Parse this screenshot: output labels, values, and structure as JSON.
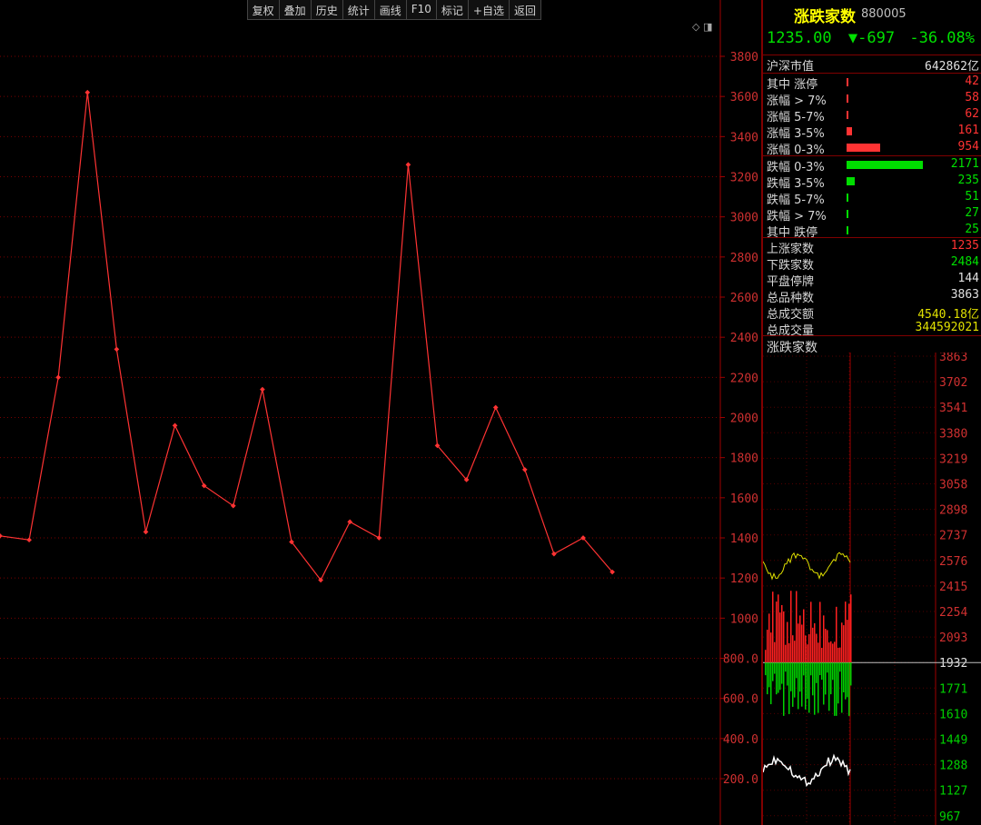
{
  "toolbar": [
    "复权",
    "叠加",
    "历史",
    "统计",
    "画线",
    "F10",
    "标记",
    "+自选",
    "返回"
  ],
  "header": {
    "title": "涨跌家数",
    "code": "880005",
    "price": "1235.00",
    "change": "-697",
    "change_pct": "-36.08%",
    "arrow": "▼"
  },
  "market_cap": {
    "label": "沪深市值",
    "value": "642862亿"
  },
  "rise_rows": [
    {
      "label": "其中 涨停",
      "value": "42",
      "count": 42
    },
    {
      "label": "涨幅 > 7%",
      "value": "58",
      "count": 58
    },
    {
      "label": "涨幅 5-7%",
      "value": "62",
      "count": 62
    },
    {
      "label": "涨幅 3-5%",
      "value": "161",
      "count": 161
    },
    {
      "label": "涨幅 0-3%",
      "value": "954",
      "count": 954
    }
  ],
  "fall_rows": [
    {
      "label": "跌幅 0-3%",
      "value": "2171",
      "count": 2171
    },
    {
      "label": "跌幅 3-5%",
      "value": "235",
      "count": 235
    },
    {
      "label": "跌幅 5-7%",
      "value": "51",
      "count": 51
    },
    {
      "label": "跌幅 > 7%",
      "value": "27",
      "count": 27
    },
    {
      "label": "其中 跌停",
      "value": "25",
      "count": 25
    }
  ],
  "stats": [
    {
      "label": "上涨家数",
      "value": "1235",
      "color": "red"
    },
    {
      "label": "下跌家数",
      "value": "2484",
      "color": "green"
    },
    {
      "label": "平盘停牌",
      "value": "144",
      "color": "white"
    },
    {
      "label": "总品种数",
      "value": "3863",
      "color": "white"
    },
    {
      "label": "总成交额",
      "value": "4540.18亿",
      "color": "yellow"
    },
    {
      "label": "总成交量",
      "value": "344592021",
      "color": "yellow"
    }
  ],
  "mini_chart": {
    "title": "涨跌家数",
    "axis_labels": [
      "3863",
      "3702",
      "3541",
      "3380",
      "3219",
      "3058",
      "2898",
      "2737",
      "2576",
      "2415",
      "2254",
      "2093",
      "1932",
      "1771",
      "1610",
      "1449",
      "1288",
      "1127",
      "967"
    ],
    "baseline": "1932"
  },
  "chart_data": {
    "type": "line",
    "y_ticks": [
      "3800",
      "3600",
      "3400",
      "3200",
      "3000",
      "2800",
      "2600",
      "2400",
      "2200",
      "2000",
      "1800",
      "1600",
      "1400",
      "1200",
      "1000",
      "800.0",
      "600.0",
      "400.0",
      "200.0"
    ],
    "ylim": [
      100,
      3900
    ],
    "series": [
      {
        "values": [
          1410,
          1390,
          2200,
          3620,
          2340,
          1430,
          1960,
          1660,
          1560,
          2140,
          1380,
          1190,
          1480,
          1400,
          3260,
          1860,
          1690,
          2050,
          1740,
          1320,
          1400,
          1230
        ]
      }
    ],
    "color": "#ff3333"
  }
}
